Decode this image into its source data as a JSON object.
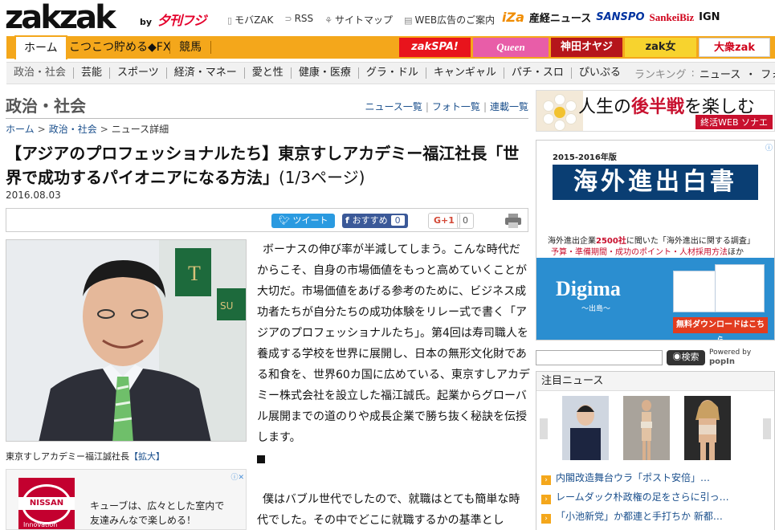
{
  "header": {
    "logo": "zakzak",
    "logo_by": "by",
    "logo_partner": "夕刊フジ",
    "links": [
      {
        "icon": "phone-icon",
        "label": "モバZAK"
      },
      {
        "icon": "rss-icon",
        "label": "RSS"
      },
      {
        "icon": "sitemap-icon",
        "label": "サイトマップ"
      },
      {
        "icon": "doc-icon",
        "label": "WEB広告のご案内"
      }
    ],
    "partners": [
      "iZa",
      "産経ニュース",
      "SANSPO",
      "SankeiBiz",
      "IGN"
    ]
  },
  "nav_primary": {
    "tabs": [
      "ホーム",
      "こつこつ貯める◆FX",
      "競馬"
    ],
    "active_tab": "ホーム",
    "banners": [
      "zakSPA!",
      "Queen",
      "神田オヤジ",
      "zak女",
      "大衆zak"
    ]
  },
  "nav_secondary": {
    "items": [
      "政治・社会",
      "芸能",
      "スポーツ",
      "経済・マネー",
      "愛と性",
      "健康・医療",
      "グラ・ドル",
      "キャンギャル",
      "パチ・スロ",
      "ぴいぷる"
    ],
    "ranking_label": "ランキング",
    "ranking_links": [
      "ニュース",
      "フォト"
    ]
  },
  "section": {
    "title": "政治・社会",
    "links": [
      "ニュース一覧",
      "フォト一覧",
      "連載一覧"
    ]
  },
  "breadcrumb": [
    "ホーム",
    "政治・社会",
    "ニュース詳細"
  ],
  "article": {
    "title": "【アジアのプロフェッショナルたち】東京すしアカデミー福江社長「世界で成功するパイオニアになる方法」",
    "page_info": "(1/3ページ)",
    "date": "2016.08.03",
    "share": {
      "tweet_label": "ツイート",
      "fb_label": "おすすめ",
      "fb_count": "0",
      "gplus_label": "G+1",
      "gplus_count": "0"
    },
    "photo_caption": "東京すしアカデミー福江誠社長",
    "photo_zoom": "【拡大】",
    "paragraph1": "ボーナスの伸び率が半減してしまう。こんな時代だからこそ、自身の市場価値をもっと高めていくことが大切だ。市場価値をあげる参考のために、ビジネス成功者たちが自分たちの成功体験をリレー式で書く「アジアのプロフェッショナルたち」。第4回は寿司職人を養成する学校を世界に展開し、日本の無形文化財である和食を、世界60カ国に広めている、東京すしアカデミー株式会社を設立した福江誠氏。起業からグローバル展開までの道のりや成長企業で勝ち抜く秘訣を伝授します。",
    "paragraph2": "僕はバブル世代でしたので、就職はとても簡単な時代でした。その中でどこに就職するかの基準とし"
  },
  "ads": {
    "nissan": {
      "brand": "NISSAN",
      "sub": "Innovation",
      "text_line1": "キューブは、広々とした室内で",
      "text_line2": "友達みんなで楽しめる！"
    },
    "sonae": {
      "text_a": "人生の",
      "text_b": "後半戦",
      "text_c": "を楽しむ",
      "footer": "終活WEB ソナエ"
    },
    "digima": {
      "year": "2015-2016年版",
      "headline": "海外進出白書",
      "line1_a": "海外進出企業",
      "line1_b": "2500社",
      "line1_c": "に聞いた「海外進出に関する調査」",
      "line2_a": "予算・準備期間・成功のポイント・人材採用方法",
      "line2_b": "ほか",
      "brand": "Digima",
      "brand_sub": "〜出島〜",
      "cta": "無料ダウンロードはこちら"
    }
  },
  "search": {
    "placeholder": "",
    "button": "検索",
    "powered_label": "Powered by",
    "powered_brand": "popIn"
  },
  "news": {
    "title": "注目ニュース",
    "items": [
      "内閣改造舞台ウラ「ポスト安倍」…",
      "レームダック朴政権の足をさらに引っ…",
      "「小池新党」か都連と手打ちか 新都…"
    ]
  },
  "colors": {
    "accent": "#f4a71b",
    "link": "#1a4f8c",
    "red": "#c8102e"
  }
}
